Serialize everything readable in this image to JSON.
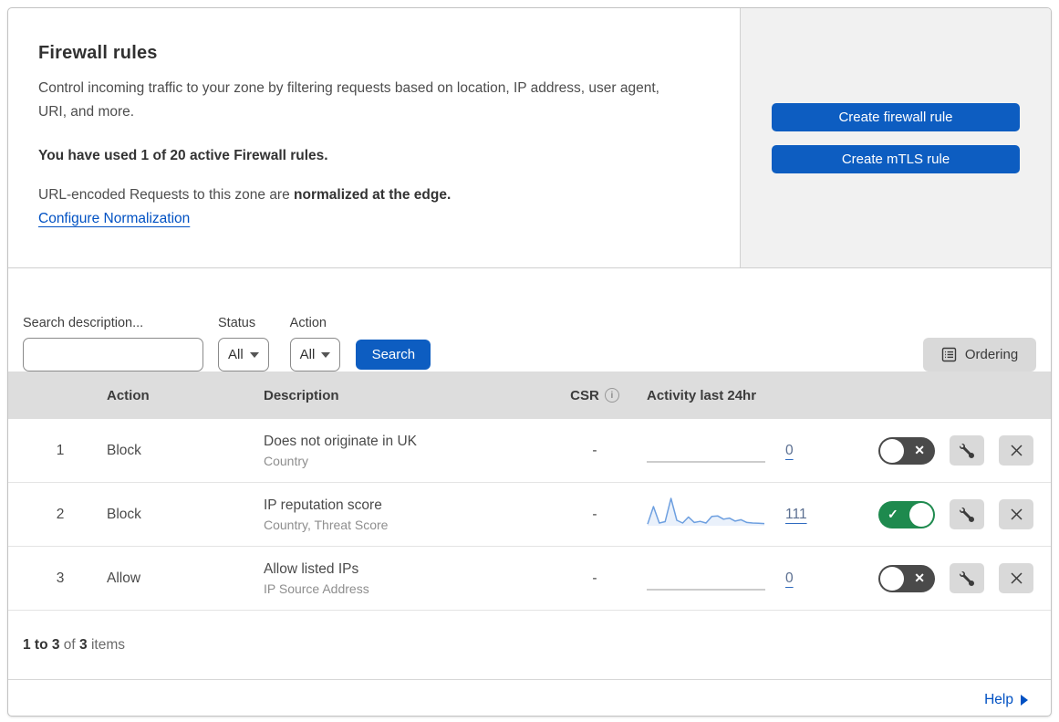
{
  "header": {
    "title": "Firewall rules",
    "description": "Control incoming traffic to your zone by filtering requests based on location, IP address, user agent, URI, and more.",
    "usage": "You have used 1 of 20 active Firewall rules.",
    "norm_prefix": "URL-encoded Requests to this zone are ",
    "norm_bold": "normalized at the edge.",
    "norm_link": "Configure Normalization",
    "create_firewall_label": "Create firewall rule",
    "create_mtls_label": "Create mTLS rule"
  },
  "filters": {
    "search_label": "Search description...",
    "status_label": "Status",
    "status_value": "All",
    "action_label": "Action",
    "action_value": "All",
    "search_button_label": "Search",
    "ordering_label": "Ordering"
  },
  "table": {
    "headers": {
      "action": "Action",
      "description": "Description",
      "csr": "CSR",
      "activity": "Activity last 24hr"
    },
    "rows": [
      {
        "num": "1",
        "action": "Block",
        "description": "Does not originate in UK",
        "fields": "Country",
        "csr": "-",
        "activity_count": "0",
        "enabled": false,
        "sparkline": [
          0,
          0,
          0,
          0,
          0,
          0,
          0,
          0,
          0,
          0,
          0,
          0,
          0,
          0,
          0,
          0,
          0,
          0,
          0,
          0,
          0
        ]
      },
      {
        "num": "2",
        "action": "Block",
        "description": "IP reputation score",
        "fields": "Country, Threat Score",
        "csr": "-",
        "activity_count": "111",
        "enabled": true,
        "sparkline": [
          0.06,
          0.7,
          0.1,
          0.15,
          1.0,
          0.2,
          0.1,
          0.32,
          0.12,
          0.16,
          0.1,
          0.34,
          0.36,
          0.24,
          0.28,
          0.17,
          0.22,
          0.12,
          0.1,
          0.09,
          0.08
        ]
      },
      {
        "num": "3",
        "action": "Allow",
        "description": "Allow listed IPs",
        "fields": "IP Source Address",
        "csr": "-",
        "activity_count": "0",
        "enabled": false,
        "sparkline": [
          0,
          0,
          0,
          0,
          0,
          0,
          0,
          0,
          0,
          0,
          0,
          0,
          0,
          0,
          0,
          0,
          0,
          0,
          0,
          0,
          0
        ]
      }
    ]
  },
  "footer": {
    "range": "1 to 3",
    "of": "of",
    "total": "3",
    "items": "items",
    "help_label": "Help"
  },
  "icons": {
    "info_glyph": "i",
    "toggle_x": "✕",
    "toggle_check": "✓"
  },
  "colors": {
    "accent_blue": "#0d5dc1",
    "link_blue": "#0051c3",
    "toggle_on_green": "#1e8a4e",
    "toggle_off_gray": "#4a4a4a",
    "sparkline_blue": "#6d9fe0",
    "panel_gray": "#f1f1f1",
    "table_header_gray": "#dddddd"
  }
}
